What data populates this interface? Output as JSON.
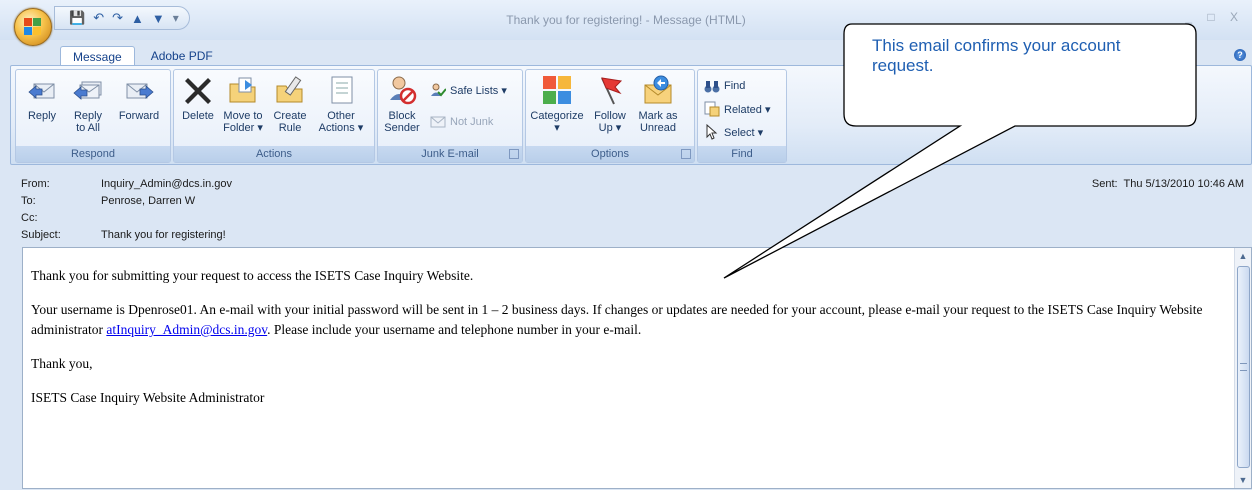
{
  "window": {
    "title": "Thank you for registering! - Message (HTML)",
    "controls": "_ □ X"
  },
  "quick_access": {
    "save_icon": "save-icon",
    "undo_icon": "undo-icon",
    "redo_icon": "redo-icon",
    "prev_icon": "previous-item-icon",
    "next_icon": "next-item-icon",
    "customize": "▾"
  },
  "tabs": [
    {
      "label": "Message",
      "active": true
    },
    {
      "label": "Adobe PDF",
      "active": false
    }
  ],
  "ribbon": {
    "respond": {
      "label": "Respond",
      "reply": "Reply",
      "reply_all_1": "Reply",
      "reply_all_2": "to All",
      "forward": "Forward"
    },
    "actions": {
      "label": "Actions",
      "delete": "Delete",
      "move_1": "Move to",
      "move_2": "Folder ▾",
      "create_1": "Create",
      "create_2": "Rule",
      "other_1": "Other",
      "other_2": "Actions ▾"
    },
    "junk": {
      "label": "Junk E-mail",
      "block_1": "Block",
      "block_2": "Sender",
      "safe_lists": "Safe Lists ▾",
      "not_junk": "Not Junk"
    },
    "options": {
      "label": "Options",
      "categorize_1": "Categorize",
      "categorize_2": "▾",
      "follow_1": "Follow",
      "follow_2": "Up ▾",
      "mark_1": "Mark as",
      "mark_2": "Unread"
    },
    "find": {
      "label": "Find",
      "find": "Find",
      "related": "Related ▾",
      "select": "Select ▾"
    }
  },
  "header": {
    "from_label": "From:",
    "from": "Inquiry_Admin@dcs.in.gov",
    "to_label": "To:",
    "to": "Penrose, Darren W",
    "cc_label": "Cc:",
    "cc": "",
    "subject_label": "Subject:",
    "subject": "Thank you for registering!",
    "sent_label": "Sent:",
    "sent": "Thu 5/13/2010 10:46 AM"
  },
  "body": {
    "p1": "Thank you for submitting your request to access the ISETS Case Inquiry Website.",
    "p2_before": "Your username is Dpenrose01. An e-mail with your initial password will be sent in 1 – 2 business days. If changes or updates are needed for your account, please e-mail your request to the ISETS Case Inquiry Website administrator ",
    "p2_link": "atInquiry_Admin@dcs.in.gov",
    "p2_after": ". Please include your username and telephone number in your e-mail.",
    "p3": "Thank you,",
    "p4": "ISETS Case Inquiry Website Administrator"
  },
  "callout": {
    "text": "This email confirms your account request."
  },
  "colors": {
    "accent": "#15428b",
    "callout_text": "#1f5fb2",
    "link": "#0000ee"
  }
}
